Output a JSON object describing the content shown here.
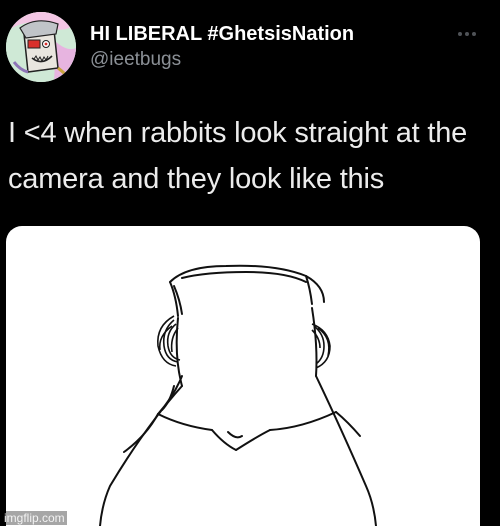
{
  "tweet": {
    "author": {
      "display_name": "HI LIBERAL #GhetsisNation",
      "handle": "@ieetbugs"
    },
    "more_icon": "more-horizontal-icon",
    "text": "I <4 when rabbits look straight at the camera and they look like this",
    "media_description_icon": "rabbit-drawing"
  },
  "watermark": "imgflip.com",
  "colors": {
    "background": "#000000",
    "text": "#e7e9ea",
    "handle": "#8b9096",
    "media_bg": "#ffffff"
  }
}
